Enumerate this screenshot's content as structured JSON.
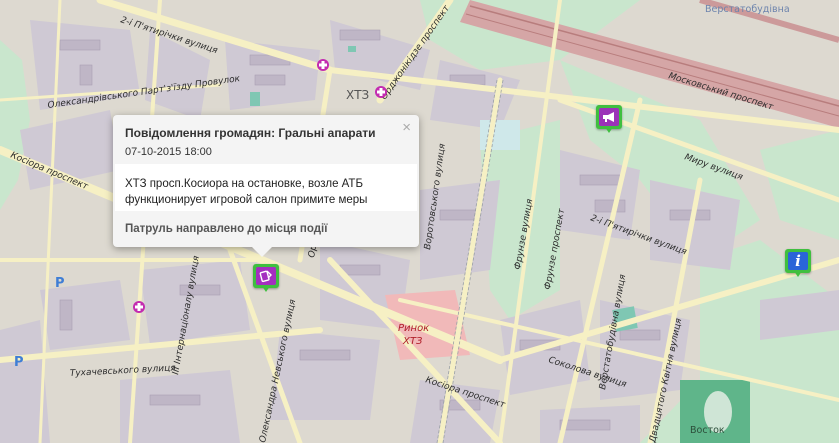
{
  "map": {
    "streets": {
      "pyatirichky_1": "2-і П'ятирічки вулиця",
      "pyatirichky_2": "2-і П'ятирічки вулиця",
      "orjonikidze": "Орджонікідзе проспект",
      "moskovsky": "Московський проспект",
      "myru": "Миру вулиця",
      "kosiora_left": "Косіора проспект",
      "kosiora_bottom": "Косіора проспект",
      "oleksandra": "Олександрівського Парт'з'їзду Провулок",
      "frunze_1": "Фрунзе вулиця",
      "frunze_2": "Фрунзе проспект",
      "vorotskaya": "Воротовського вулиця",
      "verstatobudivna": "Верстатобудівна вулиця",
      "internatsionalu": "ІІІ Інтернаціоналу вулиця",
      "tukhachevskogo": "Тухачевського вулиця",
      "sokolova": "Соколова вулиця",
      "oleksandra_p": "Олександра Невського вулиця",
      "kvitnya": "Двадцятого Квітня вулиця",
      "orj_short": "Ор"
    },
    "places": {
      "khtz": "ХТЗ",
      "rynok_1": "Ринок",
      "rynok_2": "ХТЗ",
      "verstato": "Верстатобудівна",
      "vostok": "Восток"
    }
  },
  "markers": [
    {
      "name": "casino-marker",
      "icon": "dice-card-icon",
      "color": "#a42ec0"
    },
    {
      "name": "kiosk-marker",
      "icon": "megaphone-icon",
      "color": "#9b32b8"
    },
    {
      "name": "info-marker",
      "icon": "info-icon",
      "color": "#2a64d8",
      "glyph": "i"
    }
  ],
  "popup": {
    "title": "Повідомлення громадян: Гральні апарати",
    "date": "07-10-2015 18:00",
    "text": "ХТЗ просп.Косиора на остановке, возле АТБ функционирует игровой салон примите меры",
    "status": "Патруль направлено до місця події",
    "close": "×"
  },
  "colors": {
    "land": "#ddd9d0",
    "blocks": "#cfc9d4",
    "road": "#f6f0c4",
    "park": "#c9e6cd",
    "rail": "#d5a6a6",
    "market": "#f1b9b9",
    "marker_green": "#3fbf3f"
  }
}
